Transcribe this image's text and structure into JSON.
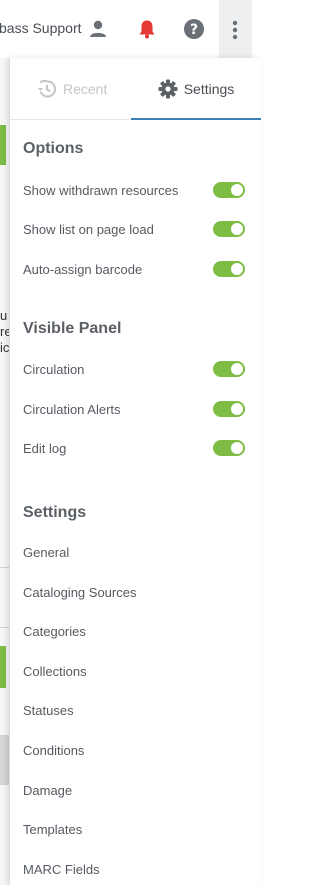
{
  "header": {
    "user_name": "bass Support",
    "icons": [
      "user-icon",
      "bell-icon",
      "help-icon",
      "more-vertical-icon"
    ],
    "bell_color": "#e53935"
  },
  "background_page": {
    "letters": [
      "u",
      "re",
      "ic"
    ]
  },
  "panel": {
    "tabs": {
      "recent": "Recent",
      "settings": "Settings",
      "active_tab": "settings"
    },
    "options": {
      "title": "Options",
      "items": [
        {
          "label": "Show withdrawn resources",
          "on": true
        },
        {
          "label": "Show list on page load",
          "on": true
        },
        {
          "label": "Auto-assign barcode",
          "on": true
        }
      ]
    },
    "visible_panel": {
      "title": "Visible Panel",
      "items": [
        {
          "label": "Circulation",
          "on": true
        },
        {
          "label": "Circulation Alerts",
          "on": true
        },
        {
          "label": "Edit log",
          "on": true
        }
      ]
    },
    "settings": {
      "title": "Settings",
      "items": [
        "General",
        "Cataloging Sources",
        "Categories",
        "Collections",
        "Statuses",
        "Conditions",
        "Damage",
        "Templates",
        "MARC Fields"
      ]
    }
  },
  "colors": {
    "toggle_on": "#7dbd44",
    "active_tab_underline": "#3c7fb5"
  }
}
